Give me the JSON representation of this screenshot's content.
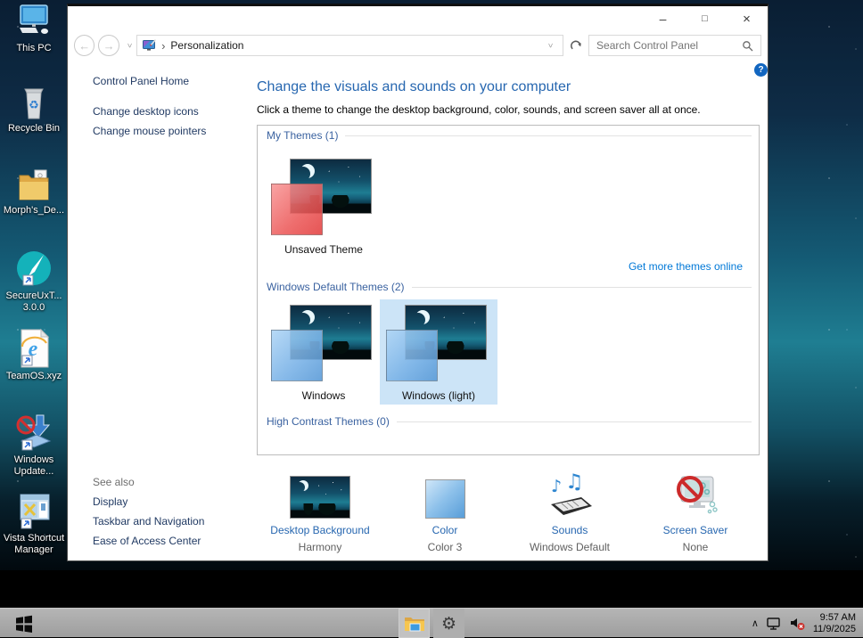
{
  "desktop": {
    "icons": [
      {
        "label": "This PC"
      },
      {
        "label": "Recycle Bin"
      },
      {
        "label": "Morph's_De..."
      },
      {
        "label": "SecureUxT...\n3.0.0"
      },
      {
        "label": "TeamOS.xyz"
      },
      {
        "label": "Windows\nUpdate..."
      },
      {
        "label": "Vista Shortcut\nManager"
      }
    ]
  },
  "window": {
    "caption": {
      "minimize": "–",
      "maximize": "□",
      "close": "×"
    },
    "nav": {
      "back": "←",
      "forward": "→"
    },
    "breadcrumb": {
      "separator": "›",
      "location": "Personalization"
    },
    "search": {
      "placeholder": "Search Control Panel"
    },
    "help": "?",
    "sidebar": {
      "home": "Control Panel Home",
      "tasks": [
        "Change desktop icons",
        "Change mouse pointers"
      ],
      "see_also": "See also",
      "see_also_links": [
        "Display",
        "Taskbar and Navigation",
        "Ease of Access Center"
      ]
    },
    "main": {
      "heading": "Change the visuals and sounds on your computer",
      "subtitle": "Click a theme to change the desktop background, color, sounds, and screen saver all at once.",
      "group_my": "My Themes (1)",
      "group_default": "Windows Default Themes (2)",
      "group_contrast": "High Contrast Themes (0)",
      "get_more": "Get more themes online",
      "theme_unsaved": "Unsaved Theme",
      "theme_windows": "Windows",
      "theme_windows_light": "Windows (light)",
      "bottom": [
        {
          "label": "Desktop Background",
          "value": "Harmony"
        },
        {
          "label": "Color",
          "value": "Color 3"
        },
        {
          "label": "Sounds",
          "value": "Windows Default"
        },
        {
          "label": "Screen Saver",
          "value": "None"
        }
      ]
    }
  },
  "taskbar": {
    "time": "9:57 AM",
    "date": "11/9/2025"
  },
  "colors": {
    "accent_blue": "#0078d7",
    "heading_blue": "#2767b0",
    "selection_blue": "#cce4f7",
    "taskbar_gray": "#a6a6a6"
  }
}
